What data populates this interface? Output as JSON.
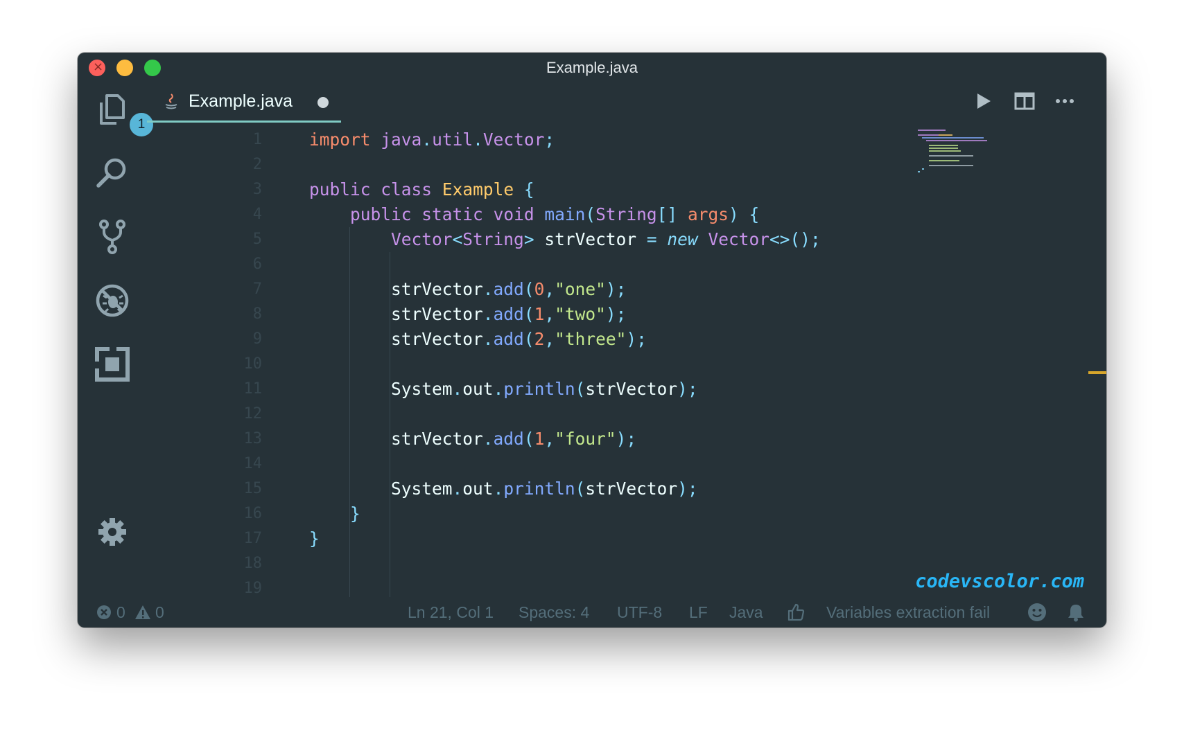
{
  "window": {
    "title": "Example.java"
  },
  "activity_bar": {
    "items": [
      {
        "name": "explorer",
        "icon": "files-icon",
        "badge": "1"
      },
      {
        "name": "search",
        "icon": "search-icon"
      },
      {
        "name": "source-control",
        "icon": "source-control-icon"
      },
      {
        "name": "debug",
        "icon": "debug-icon"
      },
      {
        "name": "extensions",
        "icon": "extensions-icon"
      },
      {
        "name": "settings",
        "icon": "gear-icon"
      }
    ]
  },
  "tab": {
    "label": "Example.java",
    "icon": "java-icon",
    "modified": true
  },
  "toolbar": {
    "run_icon": "play-icon",
    "split_icon": "split-editor-icon",
    "more_icon": "more-icon"
  },
  "editor": {
    "line_numbers": [
      "1",
      "2",
      "3",
      "4",
      "5",
      "6",
      "7",
      "8",
      "9",
      "10",
      "11",
      "12",
      "13",
      "14",
      "15",
      "16",
      "17",
      "18",
      "19"
    ],
    "lines": [
      "import java.util.Vector;",
      "",
      "public class Example {",
      "    public static void main(String[] args) {",
      "        Vector<String> strVector = new Vector<>();",
      "",
      "        strVector.add(0,\"one\");",
      "        strVector.add(1,\"two\");",
      "        strVector.add(2,\"three\");",
      "",
      "        System.out.println(strVector);",
      "",
      "        strVector.add(1,\"four\");",
      "",
      "        System.out.println(strVector);",
      "    }",
      "}",
      "",
      ""
    ]
  },
  "watermark": "codevscolor.com",
  "statusbar": {
    "errors": "0",
    "warnings": "0",
    "position": "Ln 21, Col 1",
    "indent": "Spaces: 4",
    "encoding": "UTF-8",
    "eol": "LF",
    "language": "Java",
    "message": "Variables extraction fail",
    "feedback_icon": "smiley-icon",
    "notifications_icon": "bell-icon"
  },
  "colors": {
    "background": "#263238",
    "keyword": "#c792ea",
    "import": "#f78c6c",
    "class": "#ffcb6b",
    "function": "#82aaff",
    "punctuation": "#89ddff",
    "string": "#c3e88d",
    "number": "#f78c6c",
    "accent": "#80cbc4"
  }
}
